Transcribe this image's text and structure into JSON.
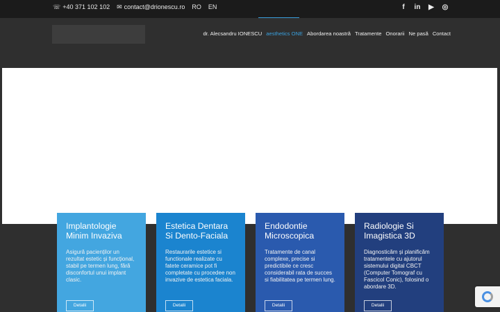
{
  "topbar": {
    "phone": "+40 371 102 102",
    "phone_icon": "☏",
    "email": "contact@drionescu.ro",
    "email_icon": "✉",
    "lang_ro": "RO",
    "lang_en": "EN",
    "social": [
      {
        "name": "facebook-icon",
        "glyph": "f"
      },
      {
        "name": "linkedin-icon",
        "glyph": "in"
      },
      {
        "name": "youtube-icon",
        "glyph": "▶"
      },
      {
        "name": "instagram-icon",
        "glyph": "◎"
      }
    ]
  },
  "nav": {
    "items": [
      "dr. Alecsandru IONESCU",
      "aesthetics ONE",
      "Abordarea noastră",
      "Tratamente",
      "Onorarii",
      "Ne pasă",
      "Contact"
    ],
    "active_index": 1,
    "active_color": "#3aa0de"
  },
  "cards": [
    {
      "title": "Implantologie Minim Invaziva",
      "text": "Asigură pacienților un rezultat estetic și funcțional, stabil pe termen lung, fără disconfortul unui implant clasic.",
      "button": "Detalii",
      "color": "#43a6e0"
    },
    {
      "title": "Estetica Dentara Si Dento-Faciala",
      "text": "Restaurarile estetice si functionale realizate cu fatete ceramice pot fi completate cu procedee non invazive de estetica faciala.",
      "button": "Detalii",
      "color": "#1b84cf"
    },
    {
      "title": "Endodontie Microscopica",
      "text": "Tratamente de canal complexe, precise si predictibile ce cresc considerabil rata de succes si fiabilitatea pe termen lung.",
      "button": "Detalii",
      "color": "#2a5aae"
    },
    {
      "title": "Radiologie Si Imagistica 3D",
      "text": "Diagnosticăm și planificăm tratamentele cu ajutorul sistemului digital CBCT (Computer Tomograf cu Fascicol Conic), folosind o abordare 3D.",
      "button": "Detalii",
      "color": "#223f7e"
    }
  ]
}
